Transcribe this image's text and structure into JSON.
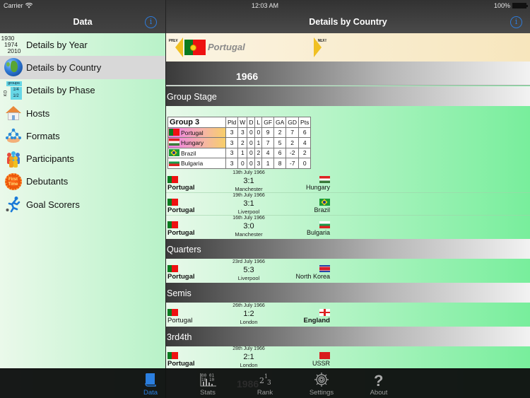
{
  "status_bar": {
    "carrier": "Carrier",
    "time": "12:03 AM",
    "battery": "100%"
  },
  "sidebar": {
    "title": "Data",
    "info_icon": "i",
    "items": [
      {
        "label": "Details by Year",
        "icon": "years-icon",
        "icon_text": [
          "1930",
          "1974",
          "2010"
        ],
        "selected": false
      },
      {
        "label": "Details by Country",
        "icon": "globe-icon",
        "selected": true
      },
      {
        "label": "Details by Phase",
        "icon": "phase-icon",
        "icon_text": [
          "groups",
          "1/4",
          "1/2",
          "KO"
        ],
        "selected": false
      },
      {
        "label": "Hosts",
        "icon": "house-icon",
        "selected": false
      },
      {
        "label": "Formats",
        "icon": "tree-icon",
        "selected": false
      },
      {
        "label": "Participants",
        "icon": "people-icon",
        "selected": false
      },
      {
        "label": "Debutants",
        "icon": "first-time-badge-icon",
        "icon_text": [
          "First",
          "Time"
        ],
        "selected": false
      },
      {
        "label": "Goal Scorers",
        "icon": "footballer-icon",
        "selected": false
      }
    ]
  },
  "detail": {
    "title": "Details by Country",
    "info_icon": "i",
    "country_nav": {
      "prev_label": "PREV",
      "next_label": "NEXT",
      "country": "Portugal"
    },
    "year": "1966",
    "ghost_next_year": "1986",
    "group_stage": {
      "heading": "Group Stage",
      "group_name": "Group 3",
      "columns": [
        "Pld",
        "W",
        "D",
        "L",
        "GF",
        "GA",
        "GD",
        "Pts"
      ],
      "rows": [
        {
          "team": "Portugal",
          "flag": "pt",
          "qualified": true,
          "values": [
            "3",
            "3",
            "0",
            "0",
            "9",
            "2",
            "7",
            "6"
          ]
        },
        {
          "team": "Hungary",
          "flag": "hu",
          "qualified": true,
          "values": [
            "3",
            "2",
            "0",
            "1",
            "7",
            "5",
            "2",
            "4"
          ]
        },
        {
          "team": "Brazil",
          "flag": "br",
          "qualified": false,
          "values": [
            "3",
            "1",
            "0",
            "2",
            "4",
            "6",
            "-2",
            "2"
          ]
        },
        {
          "team": "Bulgaria",
          "flag": "bg",
          "qualified": false,
          "values": [
            "3",
            "0",
            "0",
            "3",
            "1",
            "8",
            "-7",
            "0"
          ]
        }
      ],
      "matches": [
        {
          "date": "13th July 1966",
          "home": "Portugal",
          "home_flag": "pt",
          "away": "Hungary",
          "away_flag": "hu",
          "score": "3:1",
          "venue": "Manchester",
          "winner": "home"
        },
        {
          "date": "19th July 1966",
          "home": "Portugal",
          "home_flag": "pt",
          "away": "Brazil",
          "away_flag": "br",
          "score": "3:1",
          "venue": "Liverpool",
          "winner": "home"
        },
        {
          "date": "16th July 1966",
          "home": "Portugal",
          "home_flag": "pt",
          "away": "Bulgaria",
          "away_flag": "bg",
          "score": "3:0",
          "venue": "Manchester",
          "winner": "home"
        }
      ]
    },
    "quarters": {
      "heading": "Quarters",
      "match": {
        "date": "23rd July 1966",
        "home": "Portugal",
        "home_flag": "pt",
        "away": "North Korea",
        "away_flag": "kp",
        "score": "5:3",
        "venue": "Liverpool",
        "winner": "home"
      }
    },
    "semis": {
      "heading": "Semis",
      "match": {
        "date": "26th July 1966",
        "home": "Portugal",
        "home_flag": "pt",
        "away": "England",
        "away_flag": "en",
        "score": "1:2",
        "venue": "London",
        "winner": "away"
      }
    },
    "third_place": {
      "heading": "3rd4th",
      "match": {
        "date": "28th July 1966",
        "home": "Portugal",
        "home_flag": "pt",
        "away": "USSR",
        "away_flag": "su",
        "score": "2:1",
        "venue": "London",
        "winner": "home"
      }
    }
  },
  "tabbar": {
    "accent": "#2b7fe0",
    "tabs": [
      {
        "label": "Data",
        "icon": "book-icon",
        "active": true
      },
      {
        "label": "Stats",
        "icon": "binary-chart-icon",
        "active": false
      },
      {
        "label": "Rank",
        "icon": "podium-numbers-icon",
        "active": false
      },
      {
        "label": "Settings",
        "icon": "gear-icon",
        "active": false
      },
      {
        "label": "About",
        "icon": "question-mark-icon",
        "active": false
      }
    ]
  }
}
